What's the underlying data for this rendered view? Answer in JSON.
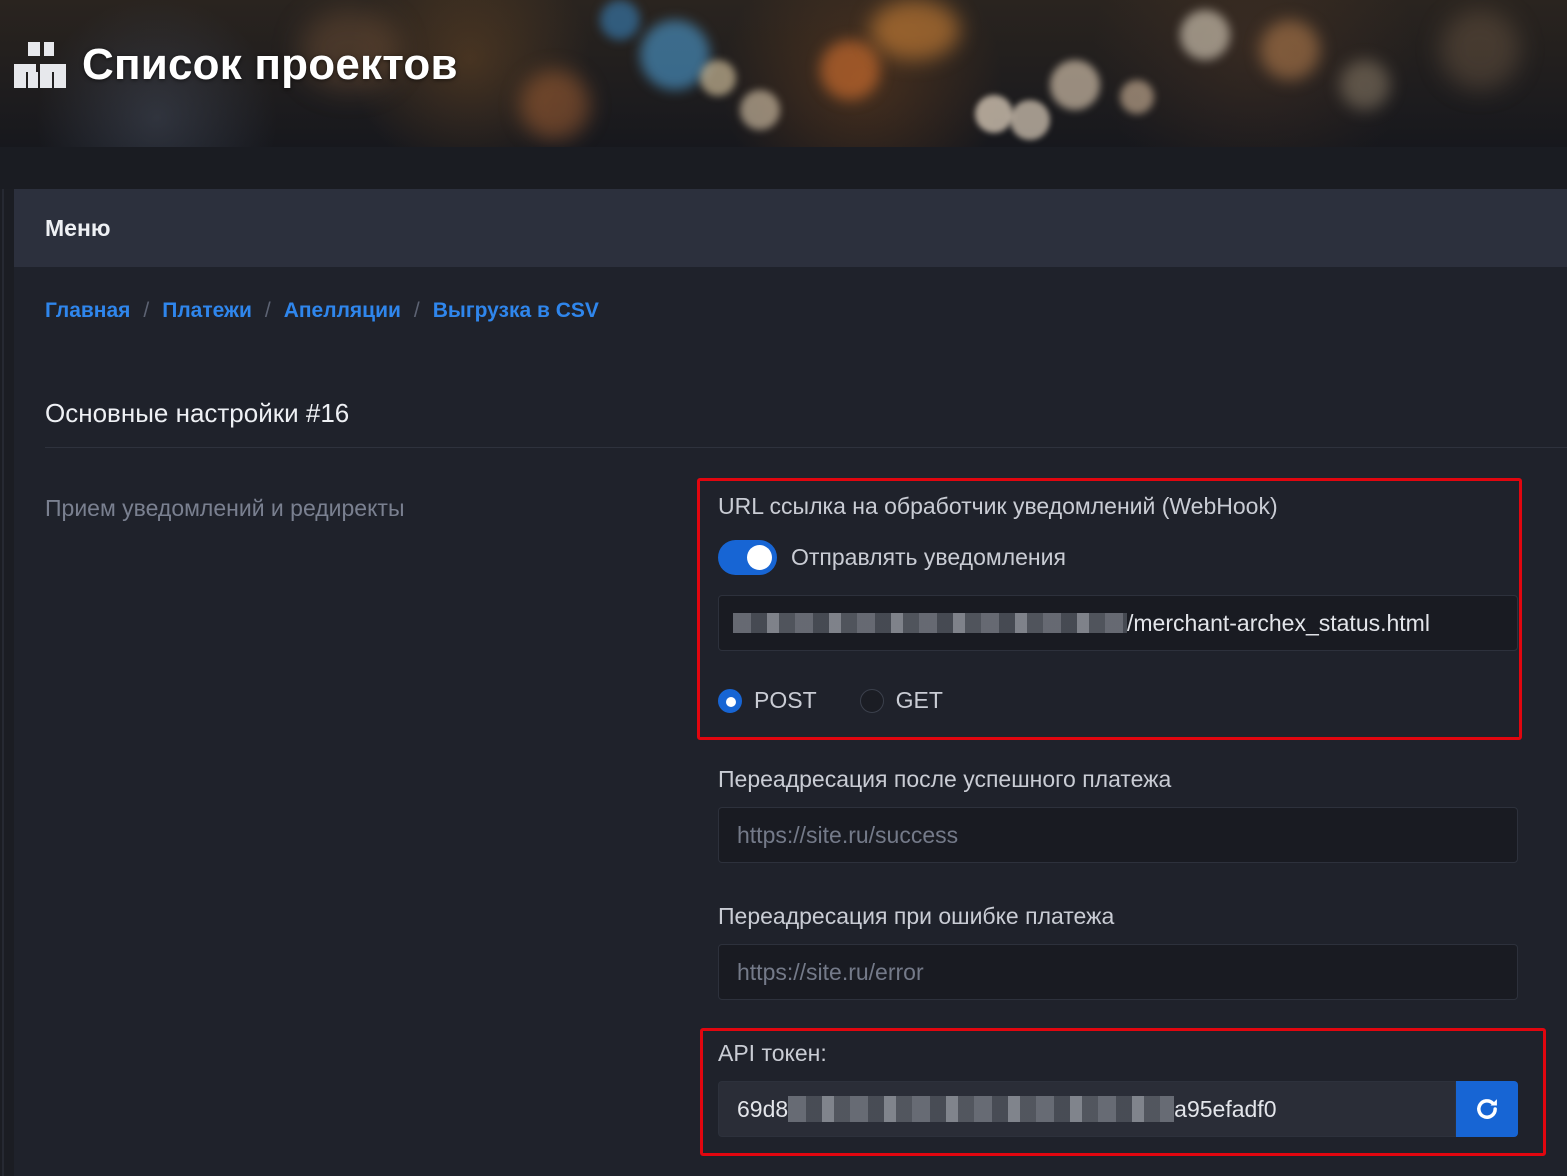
{
  "header": {
    "title": "Список проектов"
  },
  "menu": {
    "title": "Меню"
  },
  "breadcrumbs": [
    "Главная",
    "Платежи",
    "Апелляции",
    "Выгрузка в CSV"
  ],
  "section": {
    "title": "Основные настройки #16",
    "caption": "Прием уведомлений и редиректы"
  },
  "webhook": {
    "label": "URL ссылка на обработчик уведомлений (WebHook)",
    "toggle_label": "Отправлять уведомления",
    "toggle_on": true,
    "url_suffix": "/merchant-archex_status.html",
    "methods": [
      "POST",
      "GET"
    ],
    "selected_method": "POST"
  },
  "success_redirect": {
    "label": "Переадресация после успешного платежа",
    "placeholder": "https://site.ru/success"
  },
  "error_redirect": {
    "label": "Переадресация при ошибке платежа",
    "placeholder": "https://site.ru/error"
  },
  "api_token": {
    "label": "API токен:",
    "prefix": "69d8",
    "suffix": "a95efadf0"
  },
  "colors": {
    "accent": "#1765d4",
    "link": "#2f86ec",
    "highlight": "#e1060f"
  },
  "icons": {
    "logo": "blocks-logo-icon",
    "refresh": "refresh-icon"
  }
}
